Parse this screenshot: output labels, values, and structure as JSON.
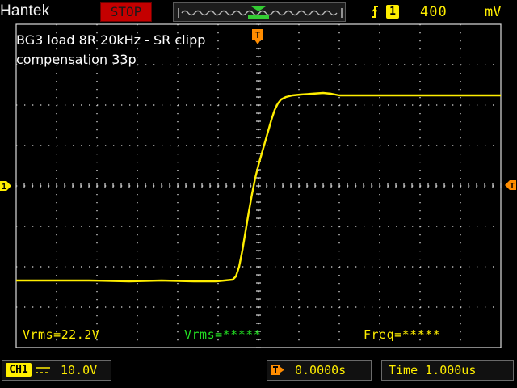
{
  "header": {
    "brand": "Hantek",
    "run_status": "STOP",
    "trigger": {
      "edge_icon": "rising-edge-icon",
      "source": "1",
      "level": "400",
      "unit": "mV"
    }
  },
  "notes": {
    "line1": "BG3 load 8R 20kHz - SR clipp",
    "line2": "compensation 33p"
  },
  "measurements": {
    "m1": "Vrms=22.2V",
    "m2": "Vrms=*****",
    "m3": "Freq=*****"
  },
  "footer": {
    "channel_label": "CH1",
    "coupling_icon": "dc-coupling-icon",
    "channel_scale": "10.0V",
    "trigger_position_icon": "trigger-position-icon",
    "trigger_position": "0.0000s",
    "time_base": "Time 1.000us"
  },
  "markers": {
    "trigger_top": "T",
    "channel_left": "1"
  },
  "colors": {
    "trace": "#ffee00",
    "marker": "#ff8c00",
    "grid": "#dcdcdc",
    "stop": "#c40000",
    "meas_green": "#22dd22"
  }
}
